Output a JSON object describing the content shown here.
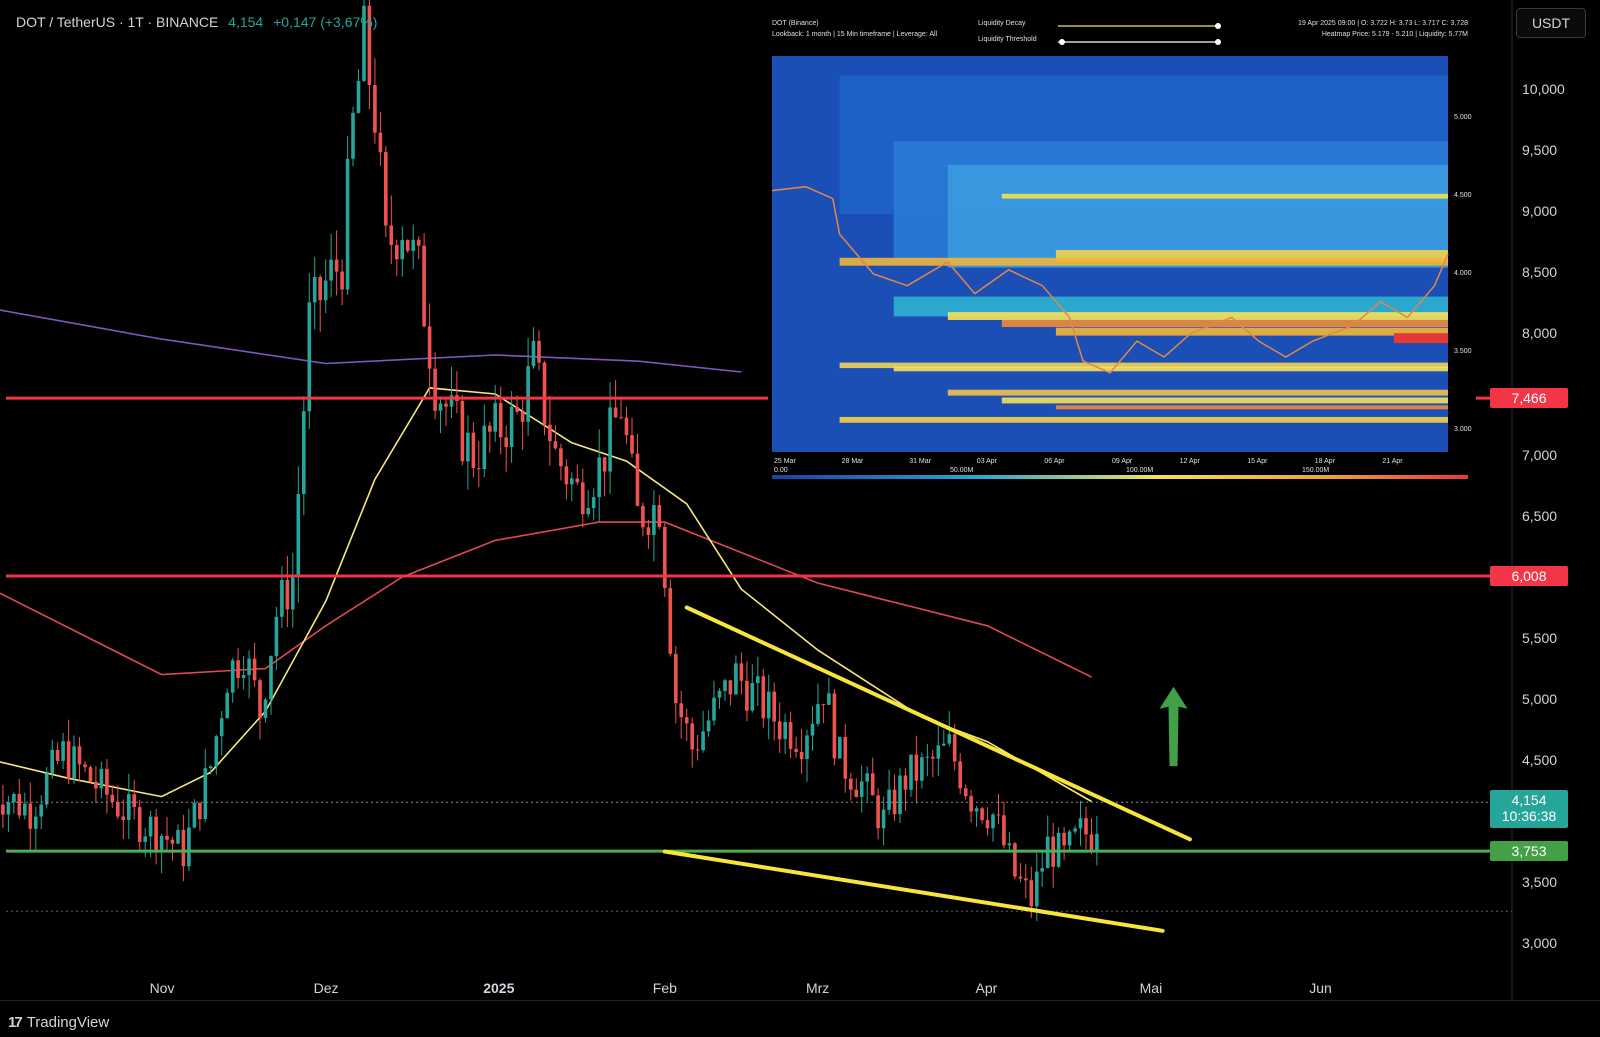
{
  "header": {
    "symbol": "DOT / TetherUS · 1T · BINANCE",
    "price": "4,154",
    "change": "+0,147 (+3,67%)"
  },
  "currency_button": "USDT",
  "brand": "TradingView",
  "colors": {
    "up": "#26a69a",
    "down": "#ef5350",
    "resistance": "#f23645",
    "support": "#4caf50",
    "ma_long": "#7e57c2",
    "ma_mid": "#e04852",
    "ma_short": "#f5e77a",
    "trendline": "#f7e53b",
    "arrow": "#43a047"
  },
  "chart_data": {
    "type": "candlestick",
    "timeframe": "1T",
    "x_tick_labels": [
      "Nov",
      "Dez",
      "2025",
      "Feb",
      "Mrz",
      "Apr",
      "Mai",
      "Jun"
    ],
    "y_tick_labels": [
      "10,000",
      "9,500",
      "9,000",
      "8,500",
      "8,000",
      "7,000",
      "6,500",
      "5,500",
      "5,000",
      "4,500",
      "3,500",
      "3,000"
    ],
    "ylim": [
      2.9,
      10.7
    ],
    "price_levels": [
      {
        "label": "7,466",
        "value": 7.466,
        "color": "#f23645"
      },
      {
        "label": "6,008",
        "value": 6.008,
        "color": "#f23645"
      },
      {
        "label": "3,753",
        "value": 3.753,
        "color": "#4caf50"
      }
    ],
    "last_price": {
      "label": "4,154",
      "countdown": "10:36:38",
      "value": 4.154
    },
    "trendlines": [
      {
        "from": {
          "date": "2025-02-05",
          "value": 5.75
        },
        "to": {
          "date": "2025-05-08",
          "value": 3.85
        }
      },
      {
        "from": {
          "date": "2025-02-01",
          "value": 3.75
        },
        "to": {
          "date": "2025-05-03",
          "value": 3.1
        }
      }
    ],
    "arrow": {
      "direction": "up",
      "from": {
        "date": "2025-05-05",
        "value": 4.45
      },
      "to": {
        "date": "2025-05-05",
        "value": 5.1
      }
    },
    "moving_averages": [
      {
        "color": "#7e57c2",
        "points": [
          [
            "2024-10-01",
            8.2
          ],
          [
            "2024-11-01",
            7.95
          ],
          [
            "2024-12-01",
            7.75
          ],
          [
            "2025-01-01",
            7.82
          ],
          [
            "2025-01-27",
            7.77
          ],
          [
            "2025-02-15",
            7.68
          ]
        ]
      },
      {
        "color": "#e04852",
        "points": [
          [
            "2024-10-01",
            5.9
          ],
          [
            "2024-11-01",
            5.2
          ],
          [
            "2024-11-20",
            5.25
          ],
          [
            "2024-12-01",
            5.6
          ],
          [
            "2024-12-15",
            6.0
          ],
          [
            "2025-01-01",
            6.3
          ],
          [
            "2025-01-20",
            6.45
          ],
          [
            "2025-02-01",
            6.45
          ],
          [
            "2025-02-15",
            6.2
          ],
          [
            "2025-03-01",
            5.95
          ],
          [
            "2025-04-01",
            5.6
          ],
          [
            "2025-04-20",
            5.18
          ]
        ]
      },
      {
        "color": "#f5e77a",
        "points": [
          [
            "2024-10-01",
            4.5
          ],
          [
            "2024-10-15",
            4.35
          ],
          [
            "2024-11-01",
            4.2
          ],
          [
            "2024-11-10",
            4.4
          ],
          [
            "2024-11-20",
            4.9
          ],
          [
            "2024-12-01",
            5.8
          ],
          [
            "2024-12-10",
            6.8
          ],
          [
            "2024-12-20",
            7.55
          ],
          [
            "2025-01-01",
            7.5
          ],
          [
            "2025-01-15",
            7.1
          ],
          [
            "2025-01-25",
            6.95
          ],
          [
            "2025-02-05",
            6.6
          ],
          [
            "2025-02-15",
            5.9
          ],
          [
            "2025-03-01",
            5.4
          ],
          [
            "2025-03-20",
            4.85
          ],
          [
            "2025-04-01",
            4.65
          ],
          [
            "2025-04-20",
            4.16
          ]
        ]
      }
    ],
    "candles_close_path": [
      [
        "2024-10-01",
        4.25
      ],
      [
        "2024-10-08",
        4.1
      ],
      [
        "2024-10-14",
        4.55
      ],
      [
        "2024-10-20",
        4.3
      ],
      [
        "2024-10-26",
        4.05
      ],
      [
        "2024-11-01",
        3.9
      ],
      [
        "2024-11-05",
        3.75
      ],
      [
        "2024-11-10",
        4.45
      ],
      [
        "2024-11-13",
        5.2
      ],
      [
        "2024-11-16",
        5.4
      ],
      [
        "2024-11-19",
        4.9
      ],
      [
        "2024-11-22",
        5.7
      ],
      [
        "2024-11-25",
        6.0
      ],
      [
        "2024-11-28",
        8.1
      ],
      [
        "2024-12-01",
        8.4
      ],
      [
        "2024-12-04",
        8.6
      ],
      [
        "2024-12-06",
        9.7
      ],
      [
        "2024-12-08",
        10.4
      ],
      [
        "2024-12-10",
        9.8
      ],
      [
        "2024-12-12",
        8.7
      ],
      [
        "2024-12-15",
        8.9
      ],
      [
        "2024-12-18",
        8.5
      ],
      [
        "2024-12-21",
        7.6
      ],
      [
        "2024-12-24",
        7.3
      ],
      [
        "2024-12-28",
        7.0
      ],
      [
        "2025-01-01",
        7.2
      ],
      [
        "2025-01-05",
        7.3
      ],
      [
        "2025-01-08",
        7.75
      ],
      [
        "2025-01-12",
        7.0
      ],
      [
        "2025-01-16",
        6.7
      ],
      [
        "2025-01-20",
        6.9
      ],
      [
        "2025-01-24",
        7.4
      ],
      [
        "2025-01-27",
        6.5
      ],
      [
        "2025-01-31",
        6.6
      ],
      [
        "2025-02-03",
        5.0
      ],
      [
        "2025-02-06",
        4.6
      ],
      [
        "2025-02-10",
        4.9
      ],
      [
        "2025-02-14",
        5.2
      ],
      [
        "2025-02-18",
        5.0
      ],
      [
        "2025-02-22",
        4.8
      ],
      [
        "2025-02-26",
        4.7
      ],
      [
        "2025-03-02",
        5.1
      ],
      [
        "2025-03-05",
        4.5
      ],
      [
        "2025-03-09",
        4.3
      ],
      [
        "2025-03-13",
        4.0
      ],
      [
        "2025-03-17",
        4.35
      ],
      [
        "2025-03-21",
        4.45
      ],
      [
        "2025-03-25",
        4.6
      ],
      [
        "2025-03-29",
        4.2
      ],
      [
        "2025-04-02",
        4.05
      ],
      [
        "2025-04-06",
        3.55
      ],
      [
        "2025-04-09",
        3.35
      ],
      [
        "2025-04-12",
        3.8
      ],
      [
        "2025-04-15",
        3.7
      ],
      [
        "2025-04-18",
        3.9
      ],
      [
        "2025-04-20",
        3.9
      ],
      [
        "2025-04-22",
        4.154
      ]
    ]
  },
  "inset": {
    "title": "DOT (Binance)",
    "subtitle": "Lookback: 1 month | 15 Min timeframe | Leverage: All",
    "control_decay": "Liquidity Decay",
    "control_threshold": "Liquidity Threshold",
    "ohlc": "19 Apr 2025 09:00 | O: 3.722 H: 3.73 L: 3.717 C: 3.728",
    "heatmap_info": "Heatmap Price: 5.179 - 5.210 | Liquidity: 5.77M",
    "x_tick_labels": [
      "25 Mar",
      "28 Mar",
      "31 Mar",
      "03 Apr",
      "06 Apr",
      "09 Apr",
      "12 Apr",
      "15 Apr",
      "18 Apr",
      "21 Apr"
    ],
    "y_tick_labels": [
      "5.000",
      "4.500",
      "4.000",
      "3.500",
      "3.000"
    ],
    "legend_ticks": [
      "0.00",
      "50.00M",
      "100.00M",
      "150.00M"
    ]
  }
}
